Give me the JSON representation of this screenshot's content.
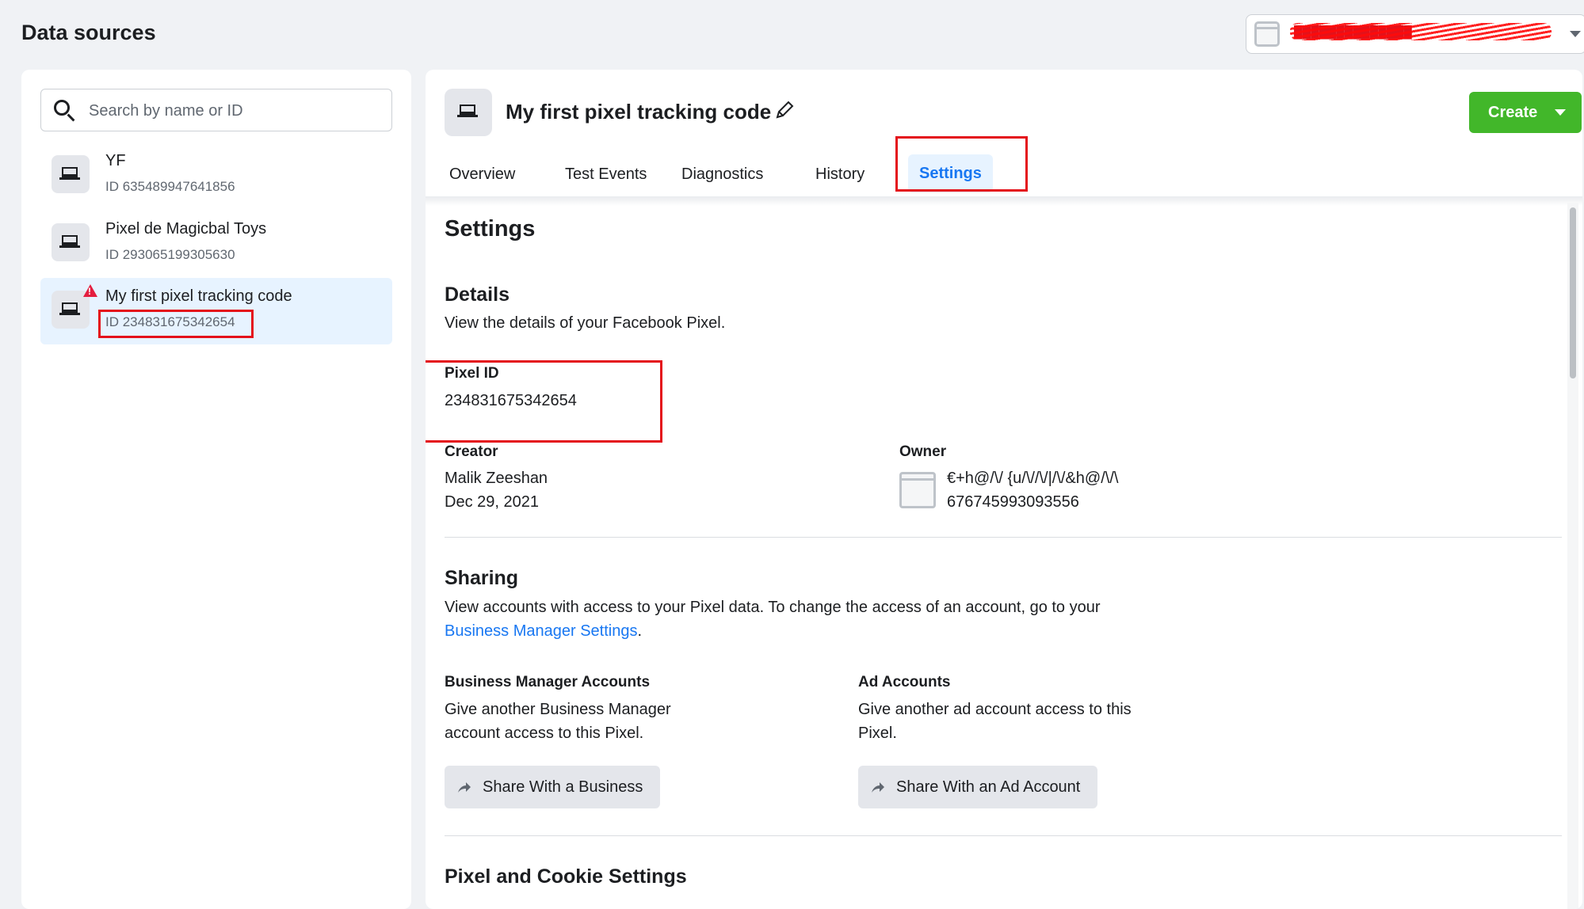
{
  "page": {
    "title": "Data sources"
  },
  "account": {
    "name": "██████████████"
  },
  "search": {
    "placeholder": "Search by name or ID"
  },
  "sidebar": {
    "items": [
      {
        "name": "YF",
        "id": "ID 635489947641856"
      },
      {
        "name": "Pixel de Magicbal Toys",
        "id": "ID 293065199305630"
      },
      {
        "name": "My first pixel tracking code",
        "id": "ID 234831675342654"
      }
    ]
  },
  "header": {
    "title": "My first pixel tracking code",
    "create_label": "Create"
  },
  "tabs": [
    "Overview",
    "Test Events",
    "Diagnostics",
    "History",
    "Settings"
  ],
  "settings": {
    "title": "Settings",
    "details": {
      "heading": "Details",
      "description": "View the details of your Facebook Pixel.",
      "pixel_id_label": "Pixel ID",
      "pixel_id_value": "234831675342654",
      "creator_label": "Creator",
      "creator_name": "Malik Zeeshan",
      "creator_date": "Dec 29, 2021",
      "owner_label": "Owner",
      "owner_name": "€+h@/\\/ {u/\\//\\/|/\\/&h@/\\/\\",
      "owner_id": "676745993093556"
    },
    "sharing": {
      "heading": "Sharing",
      "description_line1": "View accounts with access to your Pixel data. To change the access of an account, go to your",
      "link": "Business Manager Settings",
      "link_suffix": ".",
      "bm_label": "Business Manager Accounts",
      "bm_desc_line1": "Give another Business Manager",
      "bm_desc_line2": "account access to this Pixel.",
      "bm_button": "Share With a Business",
      "ad_label": "Ad Accounts",
      "ad_desc_line1": "Give another ad account access to this",
      "ad_desc_line2": "Pixel.",
      "ad_button": "Share With an Ad Account"
    },
    "cookie": {
      "heading": "Pixel and Cookie Settings"
    }
  },
  "colors": {
    "accent": "#1877f2",
    "create": "#42b72a",
    "highlight": "#e4111a",
    "selected": "#e7f3ff"
  }
}
